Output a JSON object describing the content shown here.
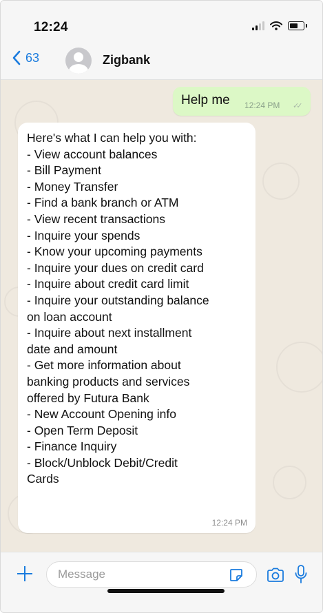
{
  "status_bar": {
    "time": "12:24"
  },
  "header": {
    "back_count": "63",
    "contact_name": "Zigbank"
  },
  "messages": {
    "outgoing": {
      "text": "Help me",
      "time": "12:24 PM"
    },
    "incoming": {
      "lines": [
        "Here's what I can help you with:",
        "- View account balances",
        "- Bill Payment",
        "- Money Transfer",
        "- Find a bank branch or ATM",
        "- View recent transactions",
        "- Inquire your spends",
        "- Know your upcoming payments",
        "- Inquire your dues on credit card",
        "- Inquire about credit card limit",
        "- Inquire your outstanding balance",
        "on loan account",
        "- Inquire about next installment",
        "date and amount",
        "- Get more information about",
        "banking products and services",
        "offered by Futura Bank",
        "- New Account Opening info",
        "- Open Term Deposit",
        "- Finance Inquiry",
        "- Block/Unblock Debit/Credit",
        "Cards"
      ],
      "time": "12:24 PM"
    }
  },
  "input": {
    "placeholder": "Message"
  },
  "colors": {
    "accent": "#1a7bde",
    "outgoing_bubble": "#dcf8c6",
    "chat_bg": "#efe9df"
  },
  "icons": [
    "back-chevron-icon",
    "avatar-icon",
    "plus-icon",
    "sticker-icon",
    "camera-icon",
    "mic-icon",
    "signal-icon",
    "wifi-icon",
    "battery-icon"
  ]
}
